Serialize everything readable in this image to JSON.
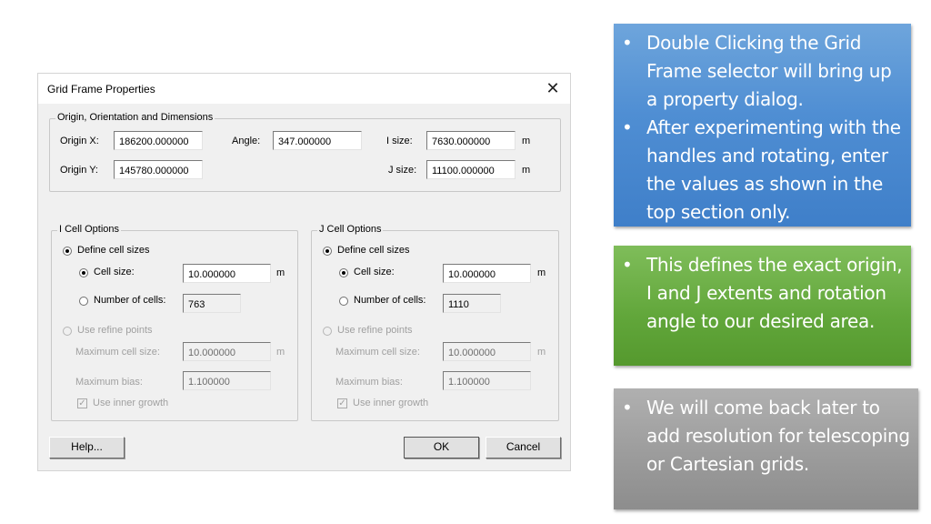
{
  "dialog": {
    "title": "Grid Frame Properties",
    "close_icon": "close-icon",
    "origin_group": {
      "label": "Origin, Orientation and Dimensions",
      "origin_x_label": "Origin X:",
      "origin_x_value": "186200.000000",
      "origin_y_label": "Origin Y:",
      "origin_y_value": "145780.000000",
      "angle_label": "Angle:",
      "angle_value": "347.000000",
      "i_size_label": "I size:",
      "i_size_value": "7630.000000",
      "i_size_unit": "m",
      "j_size_label": "J size:",
      "j_size_value": "11100.000000",
      "j_size_unit": "m"
    },
    "i_cell": {
      "label": "I Cell Options",
      "define_cell_sizes": "Define cell sizes",
      "define_cell_sizes_checked": true,
      "cell_size_label": "Cell size:",
      "cell_size_checked": true,
      "cell_size_value": "10.000000",
      "cell_size_unit": "m",
      "num_cells_label": "Number of cells:",
      "num_cells_checked": false,
      "num_cells_value": "763",
      "use_refine_points": "Use refine points",
      "max_cell_size_label": "Maximum cell size:",
      "max_cell_size_value": "10.000000",
      "max_cell_size_unit": "m",
      "max_bias_label": "Maximum bias:",
      "max_bias_value": "1.100000",
      "use_inner_growth": "Use inner growth",
      "use_inner_growth_checked": true
    },
    "j_cell": {
      "label": "J Cell Options",
      "define_cell_sizes": "Define cell sizes",
      "define_cell_sizes_checked": true,
      "cell_size_label": "Cell size:",
      "cell_size_checked": true,
      "cell_size_value": "10.000000",
      "cell_size_unit": "m",
      "num_cells_label": "Number of cells:",
      "num_cells_checked": false,
      "num_cells_value": "1110",
      "use_refine_points": "Use refine points",
      "max_cell_size_label": "Maximum cell size:",
      "max_cell_size_value": "10.000000",
      "max_cell_size_unit": "m",
      "max_bias_label": "Maximum bias:",
      "max_bias_value": "1.100000",
      "use_inner_growth": "Use inner growth",
      "use_inner_growth_checked": true
    },
    "buttons": {
      "help": "Help...",
      "ok": "OK",
      "cancel": "Cancel"
    }
  },
  "callouts": [
    {
      "color": "#4f8ed3",
      "bullets": [
        "Double Clicking the Grid Frame selector will bring up a property dialog.",
        "After experimenting with the handles and rotating, enter the values as shown in the top section only."
      ]
    },
    {
      "color": "#61a63a",
      "bullets": [
        "This defines the exact origin, I and J extents and rotation angle to our desired area."
      ]
    },
    {
      "color": "#9a9a9a",
      "bullets": [
        "We will come back later to add resolution for telescoping or Cartesian grids."
      ]
    }
  ]
}
